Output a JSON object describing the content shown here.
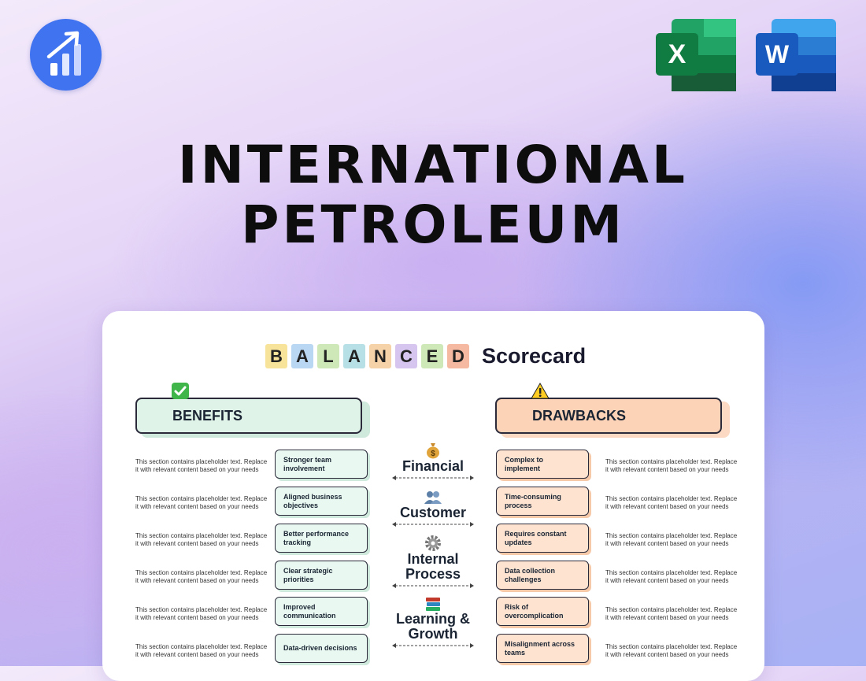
{
  "brand": {
    "logo_icon": "rising-bar-chart-icon",
    "logo_color": "#3f73f0"
  },
  "apps": [
    {
      "name": "excel",
      "letter": "X",
      "color": "#1f7a45"
    },
    {
      "name": "word",
      "letter": "W",
      "color": "#2b5fd0"
    }
  ],
  "title": {
    "line1": "INTERNATIONAL",
    "line2": "PETROLEUM"
  },
  "card": {
    "heading_letters": [
      "B",
      "A",
      "L",
      "A",
      "N",
      "C",
      "E",
      "D"
    ],
    "heading_letter_colors": [
      "#f7e39a",
      "#b9d6f2",
      "#cfe8b8",
      "#b7e0e6",
      "#f5d2a8",
      "#d6c6ef",
      "#cfe8b8",
      "#f4b9a0"
    ],
    "heading_word": "Scorecard",
    "benefits": {
      "label": "BENEFITS",
      "icon": "check-mark-icon",
      "color": "#dff3e9",
      "items": [
        "Stronger team involvement",
        "Aligned business objectives",
        "Better performance tracking",
        "Clear strategic priorities",
        "Improved communication",
        "Data-driven decisions"
      ]
    },
    "drawbacks": {
      "label": "DRAWBACKS",
      "icon": "warning-icon",
      "color": "#fcd3b6",
      "items": [
        "Complex to implement",
        "Time-consuming process",
        "Requires constant updates",
        "Data collection challenges",
        "Risk of overcomplication",
        "Misalignment across teams"
      ]
    },
    "placeholder_text": "This section contains placeholder text. Replace it with relevant content based on your needs",
    "perspectives": [
      {
        "label": "Financial",
        "icon": "money-bag-icon"
      },
      {
        "label": "Customer",
        "icon": "people-icon"
      },
      {
        "label": "Internal Process",
        "icon": "gear-icon"
      },
      {
        "label": "Learning & Growth",
        "icon": "books-icon"
      }
    ]
  }
}
